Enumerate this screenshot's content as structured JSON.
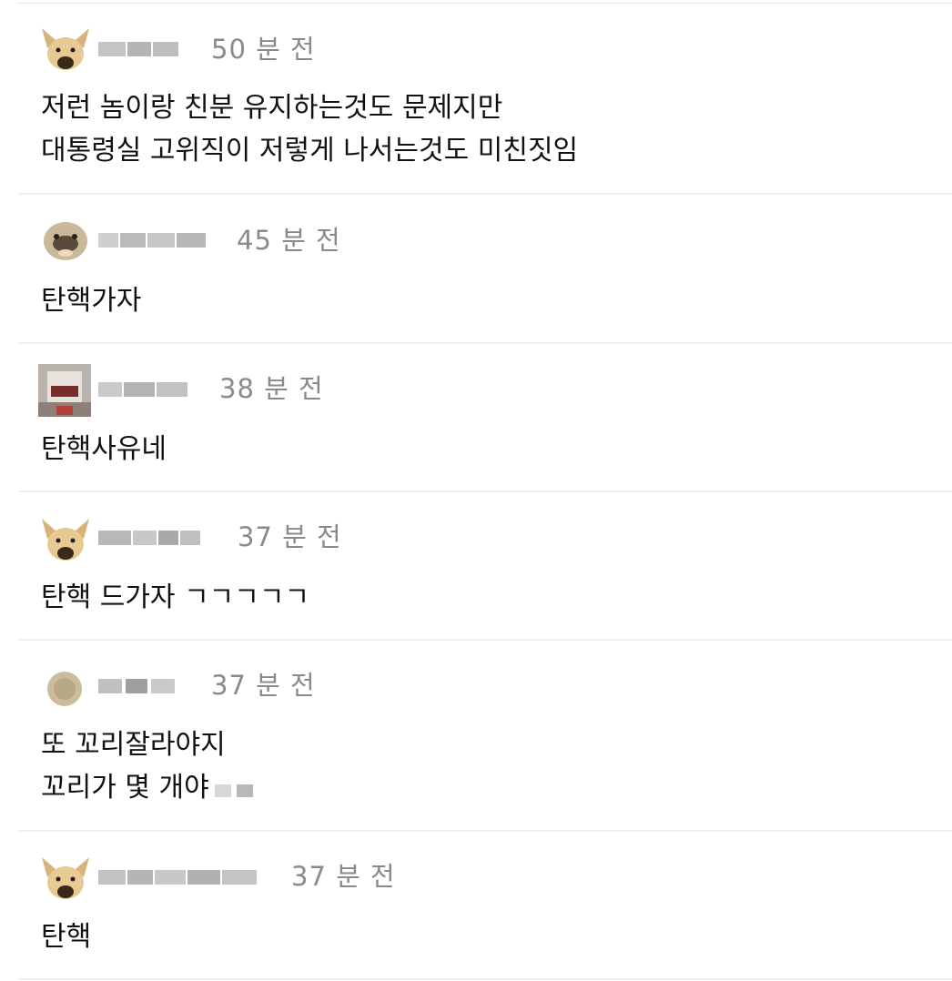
{
  "comments": [
    {
      "time": "50 분 전",
      "lines": [
        "저런 놈이랑 친분 유지하는것도 문제지만",
        "대통령실 고위직이 저렇게 나서는것도 미친짓임"
      ],
      "avatar": "dog-avatar-icon"
    },
    {
      "time": "45 분 전",
      "lines": [
        "탄핵가자"
      ],
      "avatar": "pug-avatar-icon"
    },
    {
      "time": "38 분 전",
      "lines": [
        "탄핵사유네"
      ],
      "avatar": "person-avatar-icon"
    },
    {
      "time": "37 분 전",
      "lines": [
        "탄핵 드가자 ㄱㄱㄱㄱㄱ"
      ],
      "avatar": "dog-avatar-icon"
    },
    {
      "time": "37 분 전",
      "lines": [
        "또 꼬리잘라야지",
        "꼬리가 몇 개야"
      ],
      "avatar": "round-avatar-icon"
    },
    {
      "time": "37 분 전",
      "lines": [
        "탄핵"
      ],
      "avatar": "dog-avatar-icon"
    }
  ],
  "colors": {
    "text": "#111111",
    "time": "#8a8a8a",
    "divider": "#eeeeee"
  }
}
